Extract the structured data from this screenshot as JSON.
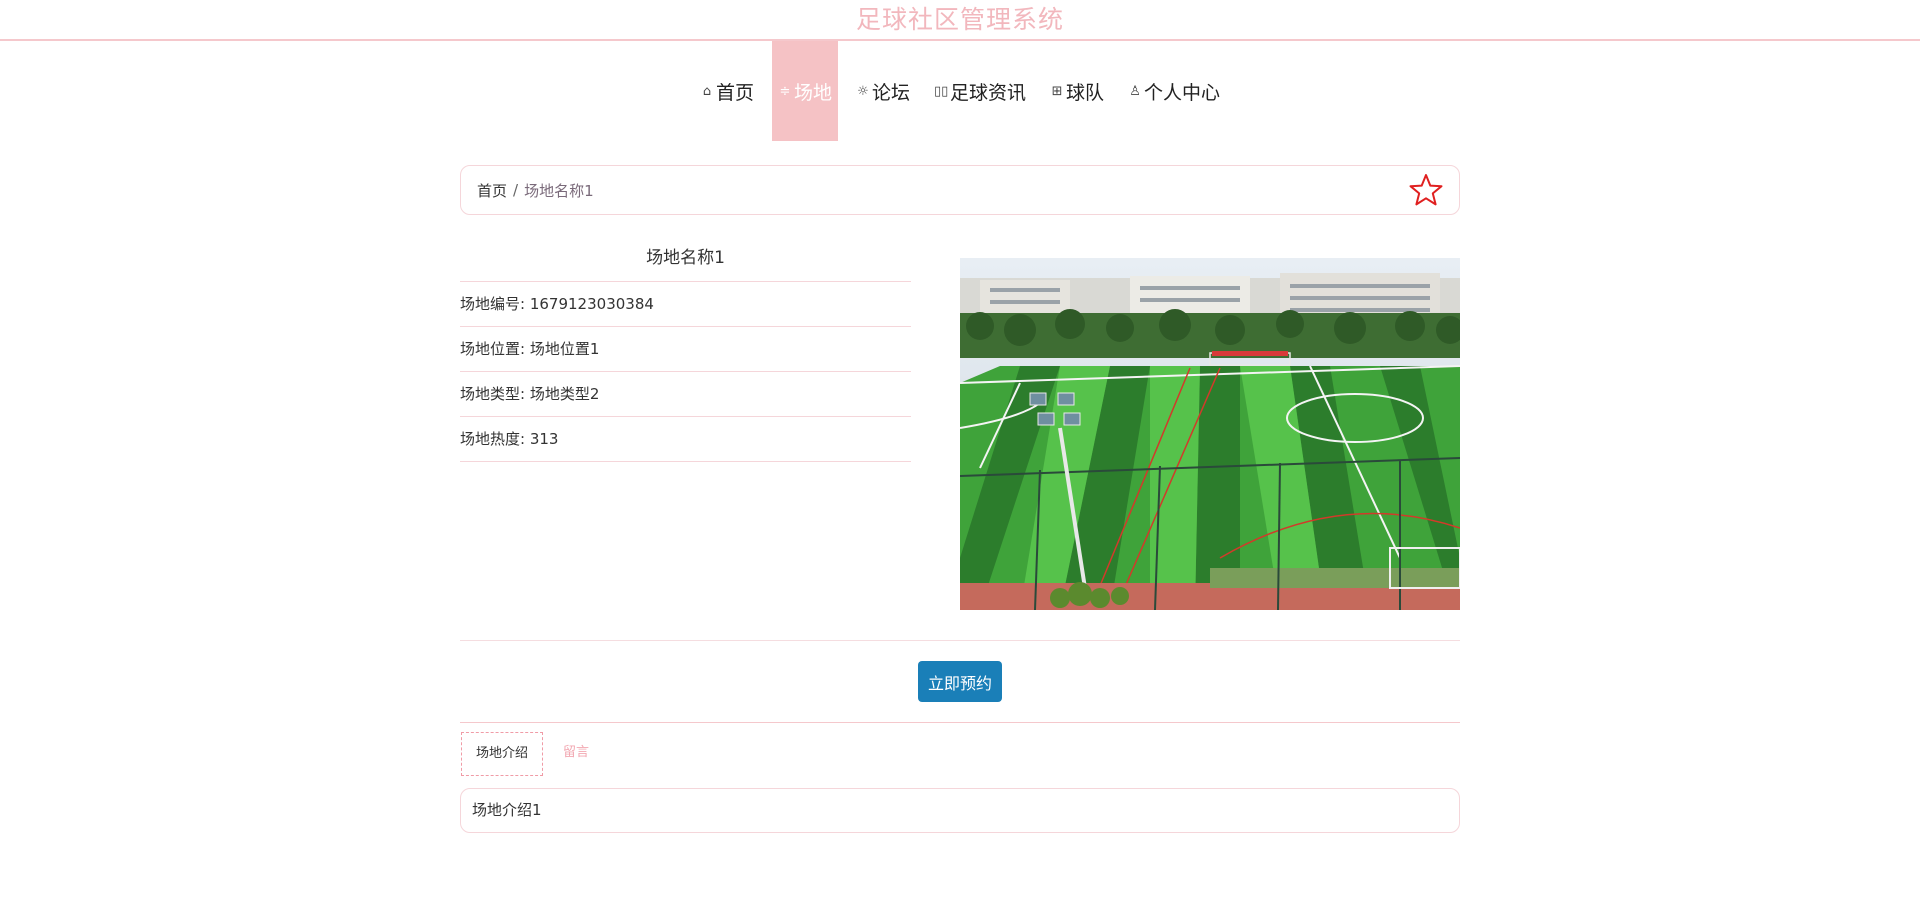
{
  "header": {
    "title": "足球社区管理系统"
  },
  "nav": {
    "items": [
      {
        "label": "首页",
        "icon": "home-icon",
        "active": false
      },
      {
        "label": "场地",
        "icon": "field-icon",
        "active": true
      },
      {
        "label": "论坛",
        "icon": "forum-icon",
        "active": false
      },
      {
        "label": "足球资讯",
        "icon": "news-icon",
        "active": false
      },
      {
        "label": "球队",
        "icon": "team-icon",
        "active": false
      },
      {
        "label": "个人中心",
        "icon": "user-icon",
        "active": false
      }
    ]
  },
  "breadcrumb": {
    "home": "首页",
    "separator": "/",
    "current": "场地名称1"
  },
  "detail": {
    "name": "场地名称1",
    "rows": [
      {
        "label": "场地编号",
        "value": "1679123030384"
      },
      {
        "label": "场地位置",
        "value": "场地位置1"
      },
      {
        "label": "场地类型",
        "value": "场地类型2"
      },
      {
        "label": "场地热度",
        "value": "313"
      }
    ]
  },
  "actions": {
    "book_label": "立即预约"
  },
  "tabs": [
    {
      "label": "场地介绍",
      "active": true
    },
    {
      "label": "留言",
      "active": false
    }
  ],
  "intro": {
    "text": "场地介绍1"
  },
  "colors": {
    "accent": "#f5c2c5",
    "button": "#1a7fb8",
    "star": "#e02020"
  }
}
